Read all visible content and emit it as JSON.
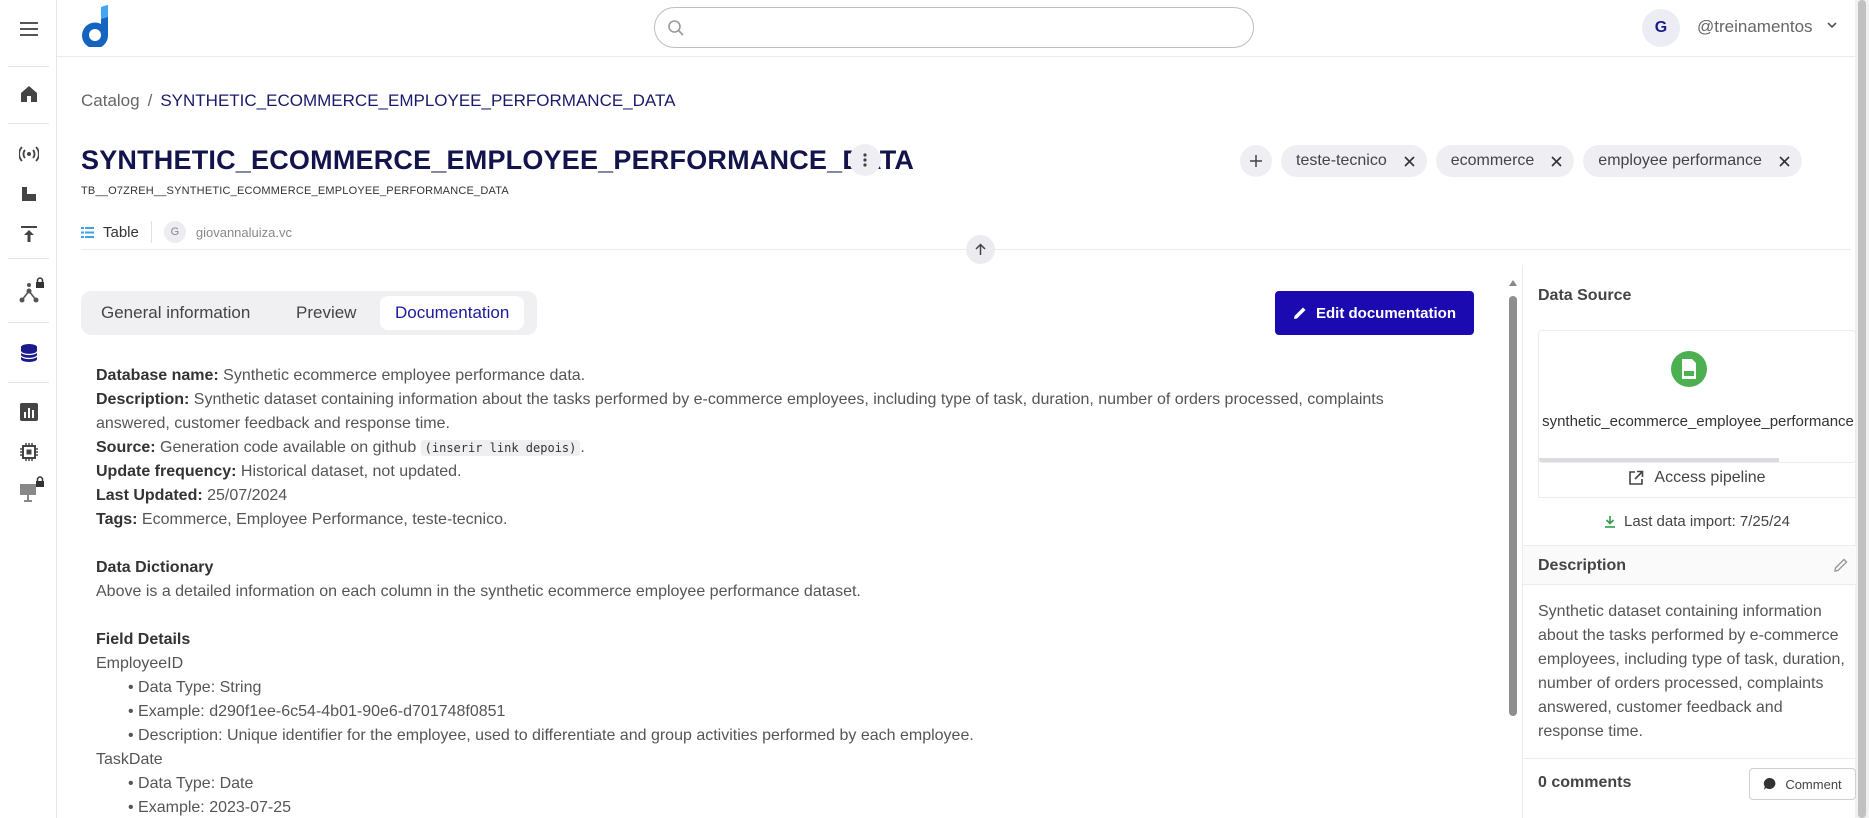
{
  "rail": {
    "items": [
      "menu-icon",
      "home-icon",
      "radio-tower-icon",
      "upload-icon",
      "deploy-icon",
      "graph-locked-icon",
      "database-icon",
      "chart-icon",
      "chip-icon",
      "board-locked-icon"
    ]
  },
  "header": {
    "search_placeholder": "",
    "avatar_initial": "G",
    "username": "@treinamentos"
  },
  "breadcrumb": {
    "root": "Catalog",
    "separator": "/",
    "current": "SYNTHETIC_ECOMMERCE_EMPLOYEE_PERFORMANCE_DATA"
  },
  "dataset": {
    "title": "SYNTHETIC_ECOMMERCE_EMPLOYEE_PERFORMANCE_DATA",
    "subtitle": "TB__O7ZREH__SYNTHETIC_ECOMMERCE_EMPLOYEE_PERFORMANCE_DATA",
    "type": "Table",
    "owner_initial": "G",
    "owner": "giovannaluiza.vc",
    "tags": [
      "teste-tecnico",
      "ecommerce",
      "employee performance"
    ]
  },
  "tabs": [
    "General information",
    "Preview",
    "Documentation"
  ],
  "active_tab": "Documentation",
  "edit_button": "Edit documentation",
  "doc": {
    "db_name_label": "Database name:",
    "db_name": " Synthetic ecommerce employee performance data.",
    "desc_label": "Description:",
    "desc": " Synthetic dataset containing information about the tasks performed by e-commerce employees, including type of task, duration, number of orders processed, complaints answered, customer feedback and response time.",
    "source_label": "Source:",
    "source": " Generation code available on github ",
    "source_code": "(inserir link depois)",
    "source_end": ".",
    "freq_label": "Update frequency:",
    "freq": " Historical dataset, not updated.",
    "updated_label": "Last Updated:",
    "updated": " 25/07/2024",
    "tags_label": "Tags:",
    "tags": " Ecommerce, Employee Performance, teste-tecnico.",
    "dict_title": "Data Dictionary",
    "dict_text": "Above is a detailed information on each column in the synthetic ecommerce employee performance dataset.",
    "fields_title": "Field Details",
    "fields": [
      {
        "name": "EmployeeID",
        "bullets": [
          "• Data Type: String",
          "• Example: d290f1ee-6c54-4b01-90e6-d701748f0851",
          "• Description: Unique identifier for the employee, used to differentiate and group activities performed by each employee."
        ]
      },
      {
        "name": "TaskDate",
        "bullets": [
          "• Data Type: Date",
          "• Example: 2023-07-25"
        ]
      }
    ]
  },
  "panel": {
    "data_source_title": "Data Source",
    "file_name": "synthetic_ecommerce_employee_performance",
    "access_pipeline": "Access pipeline",
    "last_import": "Last data import: 7/25/24",
    "description_title": "Description",
    "description": "Synthetic dataset containing information about the tasks performed by e-commerce employees, including type of task, duration, number of orders processed, complaints answered, customer feedback and response time.",
    "comments_count": "0 comments",
    "comment_button": "Comment"
  },
  "colors": {
    "primary": "#1a0ab0",
    "title": "#14144d",
    "csv_green": "#4caf50",
    "logo_blue": "#1565c0"
  }
}
